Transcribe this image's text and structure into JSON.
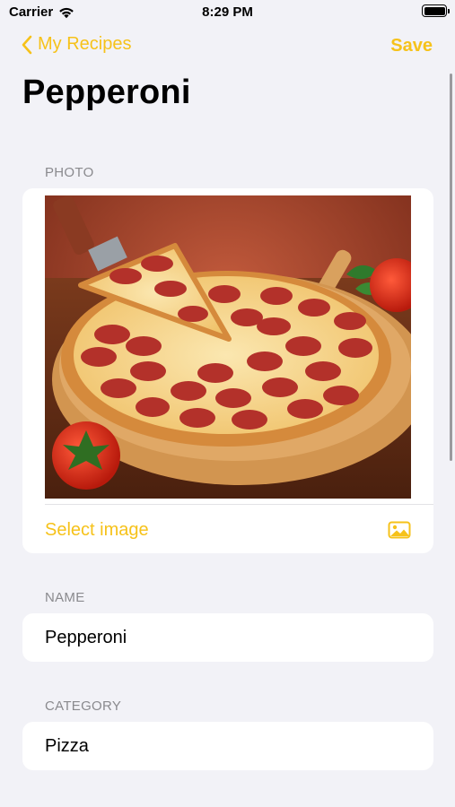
{
  "status_bar": {
    "carrier": "Carrier",
    "time": "8:29 PM"
  },
  "nav": {
    "back_label": "My Recipes",
    "save_label": "Save"
  },
  "title": "Pepperoni",
  "photo_section": {
    "header": "PHOTO",
    "select_image_label": "Select image"
  },
  "name_section": {
    "header": "NAME",
    "value": "Pepperoni"
  },
  "category_section": {
    "header": "CATEGORY",
    "value": "Pizza"
  },
  "colors": {
    "accent": "#f6c21a",
    "background": "#f2f2f7",
    "header_text": "#8a8a8e"
  },
  "icons": {
    "back": "chevron-left-icon",
    "wifi": "wifi-icon",
    "battery": "battery-icon",
    "image": "photo-icon"
  }
}
